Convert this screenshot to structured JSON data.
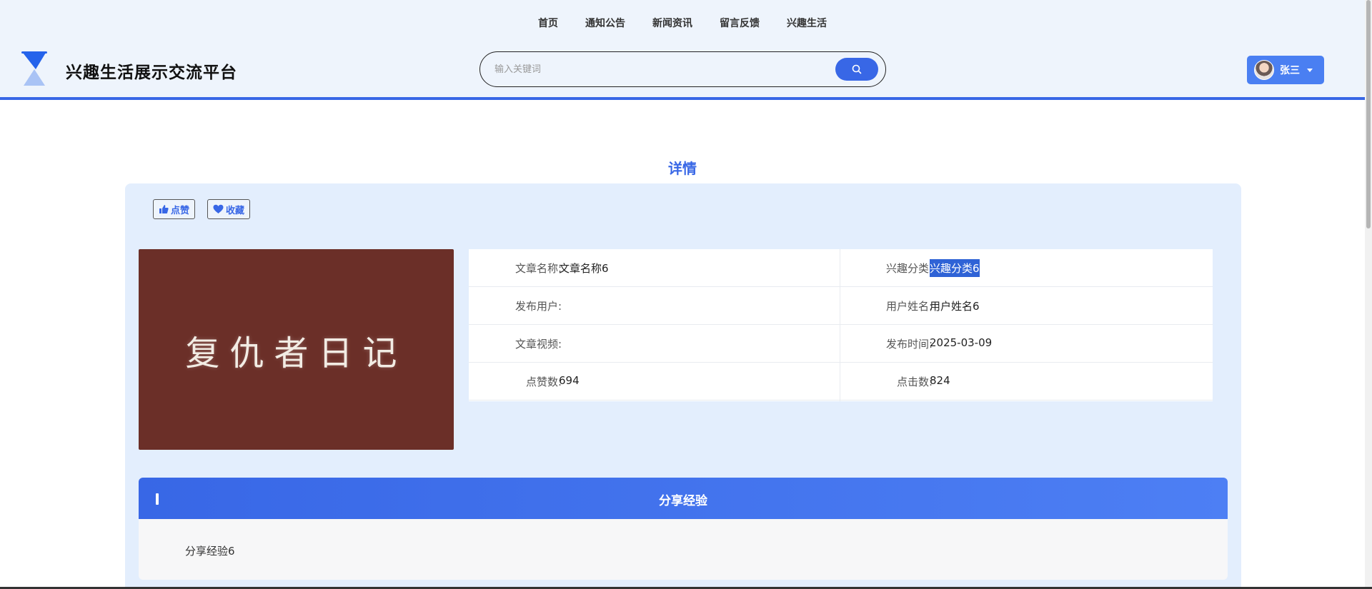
{
  "nav": {
    "items": [
      {
        "label": "首页"
      },
      {
        "label": "通知公告"
      },
      {
        "label": "新闻资讯"
      },
      {
        "label": "留言反馈"
      },
      {
        "label": "兴趣生活"
      }
    ]
  },
  "site": {
    "title": "兴趣生活展示交流平台",
    "logo_icon": "hourglass-icon"
  },
  "search": {
    "placeholder": "输入关键词",
    "value": "",
    "button_icon": "search-icon"
  },
  "user": {
    "name": "张三",
    "dropdown_icon": "caret-down-icon"
  },
  "page": {
    "heading": "详情"
  },
  "actions": {
    "like_label": "点赞",
    "like_icon": "thumbs-up-icon",
    "favorite_label": "收藏",
    "favorite_icon": "heart-icon"
  },
  "cover": {
    "text": "复仇者日记"
  },
  "details": {
    "rows": [
      {
        "left_label": "文章名称:",
        "left_value": "文章名称6",
        "right_label": "兴趣分类:",
        "right_value": "兴趣分类6"
      },
      {
        "left_label": "发布用户:",
        "left_value": "",
        "right_label": "用户姓名:",
        "right_value": "用户姓名6"
      },
      {
        "left_label": "文章视频:",
        "left_value": "",
        "right_label": "发布时间:",
        "right_value": "2025-03-09"
      },
      {
        "left_label": "点赞数:",
        "left_value": "694",
        "right_label": "点击数:",
        "right_value": "824"
      }
    ]
  },
  "share": {
    "title": "分享经验",
    "content": "分享经验6"
  },
  "colors": {
    "accent": "#3867e6",
    "header_bg": "#eef4fc",
    "panel_bg": "#e3eefd",
    "cover_bg": "#6b2f28"
  }
}
